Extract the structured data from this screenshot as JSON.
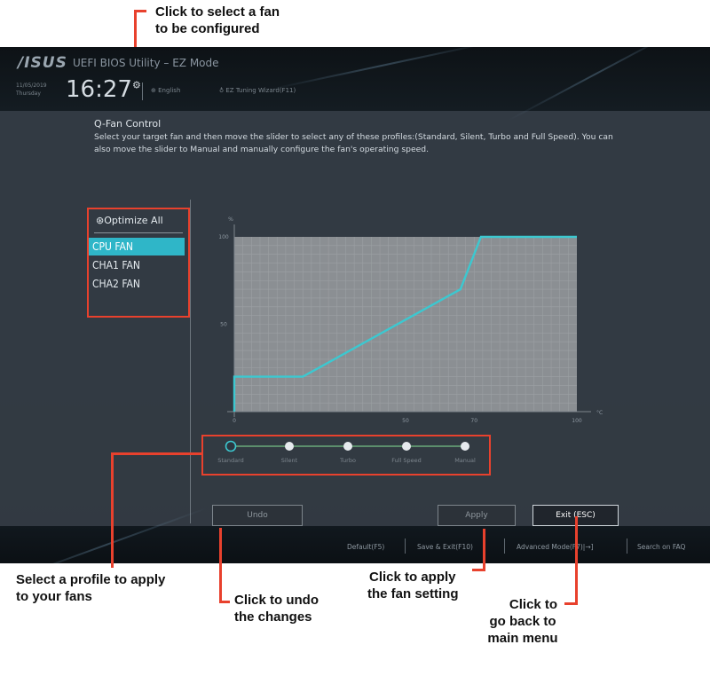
{
  "callouts": {
    "select_fan": [
      "Click to select a fan",
      "to be configured"
    ],
    "select_profile": [
      "Select a profile to apply",
      "to your fans"
    ],
    "undo": [
      "Click to undo",
      "the changes"
    ],
    "apply": [
      "Click to apply",
      "the fan setting"
    ],
    "back": [
      "Click to",
      "go back to",
      "main menu"
    ]
  },
  "bios": {
    "brand": "/ISUS",
    "title": "UEFI BIOS Utility – EZ Mode",
    "date": "11/05/2019",
    "weekday": "Thursday",
    "time": "16:27",
    "language": "English",
    "wizard": "EZ Tuning Wizard(F11)",
    "section_title": "Q-Fan Control",
    "description": "Select your target fan and then move the slider to select any of these profiles:(Standard, Silent, Turbo and Full Speed). You can also move the slider to Manual and manually configure the fan's operating speed.",
    "optimize_all": "Optimize All",
    "fans": [
      "CPU FAN",
      "CHA1 FAN",
      "CHA2 FAN"
    ],
    "selected_fan": "CPU FAN",
    "profiles": [
      "Standard",
      "Silent",
      "Turbo",
      "Full Speed",
      "Manual"
    ],
    "selected_profile": "Standard",
    "buttons": {
      "undo": "Undo",
      "apply": "Apply",
      "exit": "Exit (ESC)"
    },
    "bottom_bar": [
      "Default(F5)",
      "Save & Exit(F10)",
      "Advanced Mode(F7)|→]",
      "Search on FAQ"
    ],
    "accent": "#3cc8d0",
    "highlight": "#2fb6c8"
  },
  "chart_data": {
    "type": "line",
    "ylabel": "%",
    "xlabel": "°C",
    "x_ticks": [
      "0",
      "50",
      "70",
      "100"
    ],
    "y_ticks": [
      "100",
      "50"
    ],
    "xlim": [
      0,
      100
    ],
    "ylim": [
      0,
      100
    ],
    "series": [
      {
        "points": [
          [
            0,
            0
          ],
          [
            0,
            20
          ],
          [
            20,
            20
          ],
          [
            66,
            70
          ],
          [
            72,
            100
          ],
          [
            100,
            100
          ]
        ]
      }
    ]
  }
}
